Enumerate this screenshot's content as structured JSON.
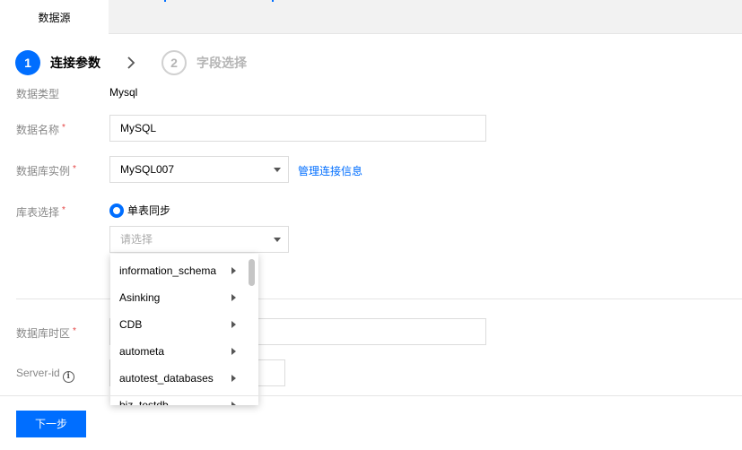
{
  "tabs": {
    "active_label": "数据源"
  },
  "steps": [
    {
      "number": "1",
      "label": "连接参数",
      "state": "active"
    },
    {
      "number": "2",
      "label": "字段选择",
      "state": "inactive"
    }
  ],
  "form": {
    "data_type": {
      "label": "数据类型",
      "value": "Mysql"
    },
    "data_name": {
      "label": "数据名称",
      "required_mark": "*",
      "value": "MySQL"
    },
    "db_instance": {
      "label": "数据库实例",
      "required_mark": "*",
      "value": "MySQL007",
      "link": "管理连接信息"
    },
    "table_select": {
      "label": "库表选择",
      "required_mark": "*",
      "radio_label": "单表同步",
      "select_placeholder": "请选择"
    },
    "db_timezone": {
      "label": "数据库时区",
      "required_mark": "*",
      "value": ""
    },
    "server_id": {
      "label": "Server-id",
      "info_glyph": "i",
      "value": ""
    }
  },
  "dropdown": {
    "items": [
      "information_schema",
      "Asinking",
      "CDB",
      "autometa",
      "autotest_databases",
      "biz_testdb"
    ]
  },
  "footer": {
    "next_label": "下一步"
  },
  "colors": {
    "accent": "#006eff",
    "required": "#e54545",
    "label": "#888888"
  }
}
